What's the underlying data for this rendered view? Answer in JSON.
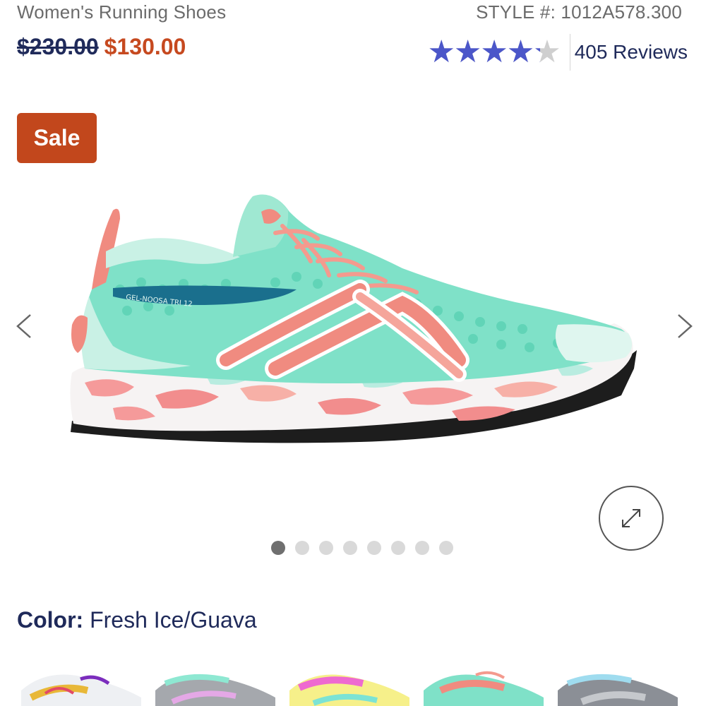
{
  "product": {
    "category": "Women's Running Shoes",
    "style_number": "STYLE #: 1012A578.300",
    "price_original": "$230.00",
    "price_sale": "$130.00",
    "rating": 0.85,
    "reviews_label": "405 Reviews"
  },
  "badge": {
    "label": "Sale"
  },
  "image": {
    "model_text": "GEL-NOOSA TRI 12"
  },
  "carousel": {
    "total_slides": 8,
    "active_index": 0
  },
  "color": {
    "label": "Color:",
    "value": "Fresh Ice/Guava"
  },
  "colors": {
    "accent_sale": "#c2471c",
    "price_sale": "#c6491f",
    "navy": "#1f2a5a",
    "star": "#4b56c9"
  },
  "swatch_variants": [
    {
      "name": "white-purple-variant"
    },
    {
      "name": "grey-mint-variant"
    },
    {
      "name": "yellow-pink-variant"
    },
    {
      "name": "fresh-ice-guava-variant"
    },
    {
      "name": "grey-blue-variant"
    }
  ]
}
